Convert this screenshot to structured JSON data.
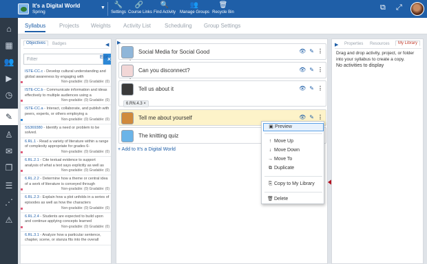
{
  "topbar": {
    "course_title": "It's a Digital World",
    "course_term": "Spring",
    "tools": [
      {
        "label": "Settings",
        "icon": "wrench-icon",
        "glyph": "🔧"
      },
      {
        "label": "Course Links",
        "icon": "link-icon",
        "glyph": "🔗"
      },
      {
        "label": "Find Activity",
        "icon": "search-icon",
        "glyph": "🔍"
      },
      {
        "label": "Manage Groups",
        "icon": "users-icon",
        "glyph": "👥"
      },
      {
        "label": "Recycle Bin",
        "icon": "trash-icon",
        "glyph": "🗑"
      }
    ]
  },
  "tabs": [
    "Syllabus",
    "Projects",
    "Weights",
    "Activity List",
    "Scheduling",
    "Group Settings"
  ],
  "left_panel": {
    "tab_objectives": "Objectives",
    "tab_badges": "Badges",
    "filter_placeholder": "Filter",
    "clear_label": "×",
    "edit_label": "Edit",
    "objectives": [
      {
        "code": "ISTE-CC.c",
        "text": " - Develop cultural understanding and global awareness by engaging with",
        "meta": "Non-gradable: (0)     Gradable: (0)",
        "dot": "#e05c7a"
      },
      {
        "code": "ISTE-CC.b",
        "text": " - Communicate information and ideas effectively to multiple audiences using a",
        "meta": "Non-gradable: (0)     Gradable: (0)",
        "dot": "#e05c7a"
      },
      {
        "code": "ISTE-CC.a",
        "text": " - Interact, collaborate, and publish with peers, experts, or others employing a",
        "meta": "Non-gradable: (0)     Gradable: (0)",
        "dot": "#2d88d6"
      },
      {
        "code": "SS369380",
        "text": " - Identify a need or problem to be solved.",
        "meta": "",
        "dot": ""
      },
      {
        "code": "6.RL.1",
        "text": " - Read a variety of literature within a range of complexity appropriate for grades 6-",
        "meta": "Non-gradable: (0)     Gradable: (0)",
        "dot": "#e05c7a"
      },
      {
        "code": "6.RL.2.1",
        "text": " - Cite textual evidence to support analysis of what a text says explicitly as well as",
        "meta": "Non-gradable: (0)     Gradable: (0)",
        "dot": "#e05c7a"
      },
      {
        "code": "6.RL.2.2",
        "text": " - Determine how a theme or central idea of a work of literature is conveyed through",
        "meta": "Non-gradable: (0)     Gradable: (0)",
        "dot": "#e05c7a"
      },
      {
        "code": "6.RL.2.3",
        "text": " - Explain how a plot unfolds in a series of episodes as well as how the characters",
        "meta": "Non-gradable: (0)     Gradable: (0)",
        "dot": "#e05c7a"
      },
      {
        "code": "6.RL.2.4",
        "text": " - Students are expected to build upon and continue applying concepts learned",
        "meta": "Non-gradable: (0)     Gradable: (0)",
        "dot": "#e05c7a"
      },
      {
        "code": "6.RL.3.1",
        "text": " - Analyze how a particular sentence, chapter, scene, or stanza fits into the overall",
        "meta": "",
        "dot": ""
      }
    ]
  },
  "center_panel": {
    "items": [
      {
        "title": "Social Media for Social Good",
        "thumb": "#8fb6d9"
      },
      {
        "title": "Can you disconnect?",
        "thumb": "#f2d7d7"
      },
      {
        "title": "Tell us about it",
        "thumb": "#3a3a3a",
        "tag": "6.RN.4.3  ×"
      },
      {
        "title": "Tell me about yourself",
        "thumb": "#d08a3c"
      },
      {
        "title": "The knitting quiz",
        "thumb": "#6bb4e8"
      }
    ],
    "add_label": "+ Add to It's a Digital World"
  },
  "context_menu": {
    "items": [
      {
        "label": "Preview",
        "icon": "image-icon",
        "glyph": "▣"
      },
      {
        "label": "Move Up",
        "icon": "arrow-up-icon",
        "glyph": "↑"
      },
      {
        "label": "Move Down",
        "icon": "arrow-down-icon",
        "glyph": "↓"
      },
      {
        "label": "Move To",
        "icon": "arrow-right-icon",
        "glyph": "→"
      },
      {
        "label": "Duplicate",
        "icon": "copy-icon",
        "glyph": "⧉"
      },
      {
        "label": "Copy to My Library",
        "icon": "library-icon",
        "glyph": "⎘"
      },
      {
        "label": "Delete",
        "icon": "trash-icon",
        "glyph": "🗑"
      }
    ]
  },
  "right_panel": {
    "tabs": [
      "Properties",
      "Resources",
      "My Library"
    ],
    "instruction": "Drag and drop activity, project, or folder into your syllabus to create a copy.",
    "empty": "No activities to display"
  },
  "colors": {
    "brand": "#1f5fa8",
    "nav_bg": "#2e3a47",
    "highlight": "#fdf3c9",
    "arrow": "#b3121f"
  }
}
